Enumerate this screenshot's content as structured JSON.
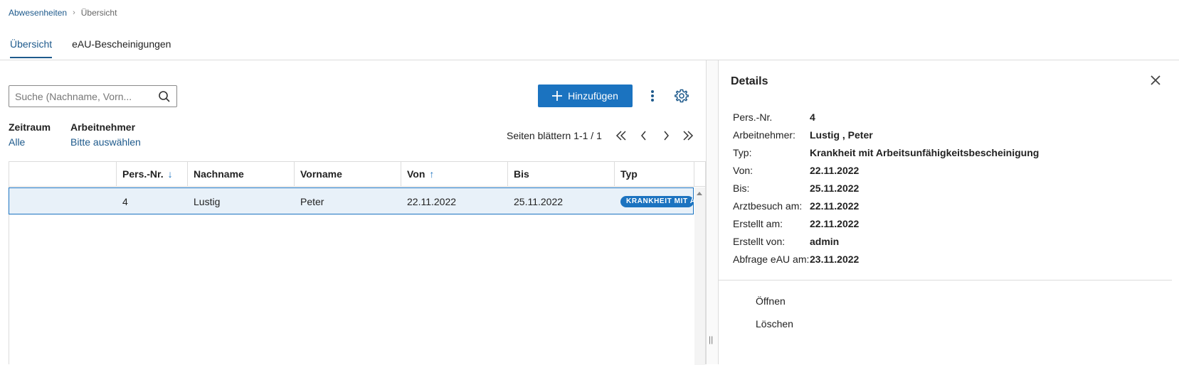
{
  "breadcrumb": {
    "parent": "Abwesenheiten",
    "current": "Übersicht"
  },
  "tabs": [
    {
      "label": "Übersicht",
      "active": true
    },
    {
      "label": "eAU-Bescheinigungen",
      "active": false
    }
  ],
  "search": {
    "placeholder": "Suche (Nachname, Vorn..."
  },
  "toolbar": {
    "add_label": "Hinzufügen"
  },
  "filters": {
    "zeitraum": {
      "label": "Zeitraum",
      "value": "Alle"
    },
    "arbeitnehmer": {
      "label": "Arbeitnehmer",
      "value": "Bitte auswählen"
    }
  },
  "pager": {
    "text": "Seiten blättern 1-1 / 1"
  },
  "table": {
    "headers": {
      "pers_nr": "Pers.-Nr.",
      "nachname": "Nachname",
      "vorname": "Vorname",
      "von": "Von",
      "bis": "Bis",
      "typ": "Typ"
    },
    "rows": [
      {
        "pers_nr": "4",
        "nachname": "Lustig",
        "vorname": "Peter",
        "von": "22.11.2022",
        "bis": "25.11.2022",
        "typ": "KRANKHEIT MIT ARBEITSUNFÄHIGKEITSBESCHEINIGUNG"
      }
    ]
  },
  "details": {
    "title": "Details",
    "fields": [
      {
        "label": "Pers.-Nr.",
        "value": "4"
      },
      {
        "label": "Arbeitnehmer:",
        "value": "Lustig , Peter"
      },
      {
        "label": "Typ:",
        "value": "Krankheit mit Arbeitsunfähigkeitsbescheinigung"
      },
      {
        "label": "Von:",
        "value": "22.11.2022"
      },
      {
        "label": "Bis:",
        "value": "25.11.2022"
      },
      {
        "label": "Arztbesuch am:",
        "value": "22.11.2022"
      },
      {
        "label": "Erstellt am:",
        "value": "22.11.2022"
      },
      {
        "label": "Erstellt von:",
        "value": "admin"
      },
      {
        "label": "Abfrage eAU am:",
        "value": "23.11.2022"
      }
    ],
    "actions": {
      "open": "Öffnen",
      "delete": "Löschen"
    }
  },
  "colors": {
    "accent": "#1b73c0",
    "link": "#1e5a8c",
    "row_selected": "#e8f1f9"
  },
  "icons": {
    "search": "search-icon",
    "add": "plus-icon",
    "more": "kebab-icon",
    "settings": "gear-icon",
    "close": "close-icon"
  }
}
